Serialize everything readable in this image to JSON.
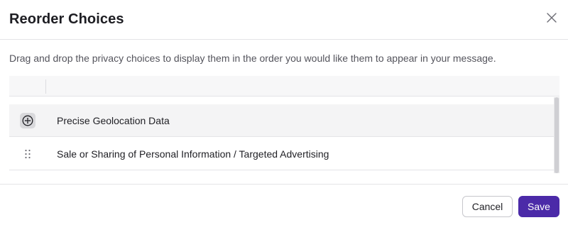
{
  "modal": {
    "title": "Reorder Choices",
    "close_icon": "close-x-icon",
    "description": "Drag and drop the privacy choices to display them in the order you would like them to appear in your message."
  },
  "table": {
    "rows": [
      {
        "label": "Precise Geolocation Data",
        "handle_icon": "drag-move-icon",
        "state": "dragging"
      },
      {
        "label": "Sale or Sharing of Personal Information / Targeted Advertising",
        "handle_icon": "drag-dots-icon",
        "state": "idle"
      }
    ]
  },
  "footer": {
    "cancel_label": "Cancel",
    "save_label": "Save"
  },
  "colors": {
    "primary": "#4b2aa8",
    "active_row": "#f4f4f5",
    "border": "#e4e4e7"
  }
}
